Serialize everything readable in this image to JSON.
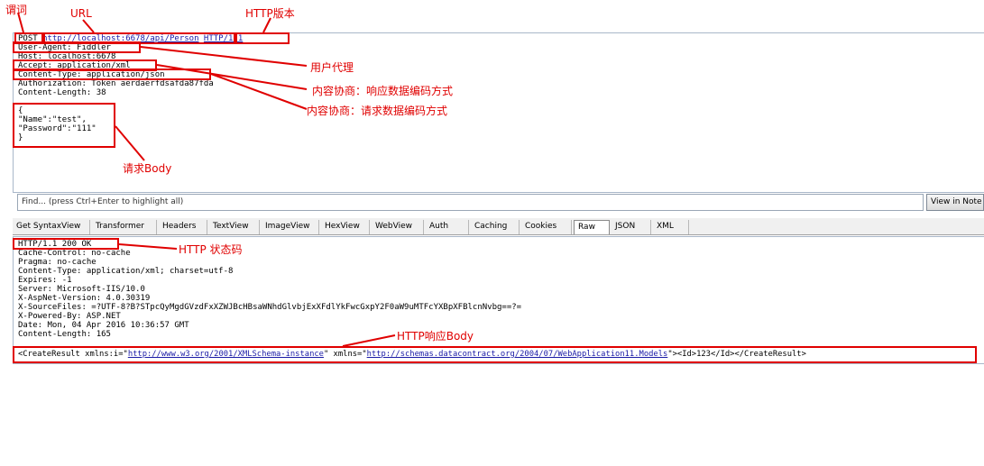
{
  "request": {
    "method": "POST",
    "url": "http://localhost:6678/api/Person",
    "version": "HTTP/1.1",
    "headers": [
      "User-Agent: Fiddler",
      "Host: localhost:6678",
      "Accept: application/xml",
      "Content-Type: application/json",
      "Authorization: Token aerdaerfdsafda87fda",
      "Content-Length: 38"
    ],
    "body": [
      "{",
      "\"Name\":\"test\",",
      "\"Password\":\"111\"",
      "}"
    ]
  },
  "find": {
    "placeholder": "Find... (press Ctrl+Enter to highlight all)",
    "view_button": "View in Note"
  },
  "tabs": [
    "Get SyntaxView",
    "Transformer",
    "Headers",
    "TextView",
    "ImageView",
    "HexView",
    "WebView",
    "Auth",
    "Caching",
    "Cookies",
    "Raw",
    "JSON",
    "XML"
  ],
  "active_tab": "Raw",
  "response": {
    "status": "HTTP/1.1 200 OK",
    "headers": [
      "Cache-Control: no-cache",
      "Pragma: no-cache",
      "Content-Type: application/xml; charset=utf-8",
      "Expires: -1",
      "Server: Microsoft-IIS/10.0",
      "X-AspNet-Version: 4.0.30319",
      "X-SourceFiles: =?UTF-8?B?STpcQyMgdGVzdFxXZWJBcHBsaWNhdGlvbjExXFdlYkFwcGxpY2F0aW9uMTFcYXBpXFBlcnNvbg==?=",
      "X-Powered-By: ASP.NET",
      "Date: Mon, 04 Apr 2016 10:36:57 GMT",
      "Content-Length: 165"
    ],
    "body": {
      "p1": "<CreateResult xmlns:i=\"",
      "link1": "http://www.w3.org/2001/XMLSchema-instance",
      "p2": "\" xmlns=\"",
      "link2": "http://schemas.datacontract.org/2004/07/WebApplication11.Models",
      "p3": "\"><Id>123</Id></CreateResult>"
    }
  },
  "annotations": {
    "method": "谓词",
    "url": "URL",
    "version": "HTTP版本",
    "user_agent": "用户代理",
    "accept": "内容协商：响应数据编码方式",
    "content_type": "内容协商：请求数据编码方式",
    "req_body": "请求Body",
    "status": "HTTP 状态码",
    "resp_body": "HTTP响应Body"
  },
  "colors": {
    "annotation": "#e00000",
    "link": "#1a1aa6"
  }
}
